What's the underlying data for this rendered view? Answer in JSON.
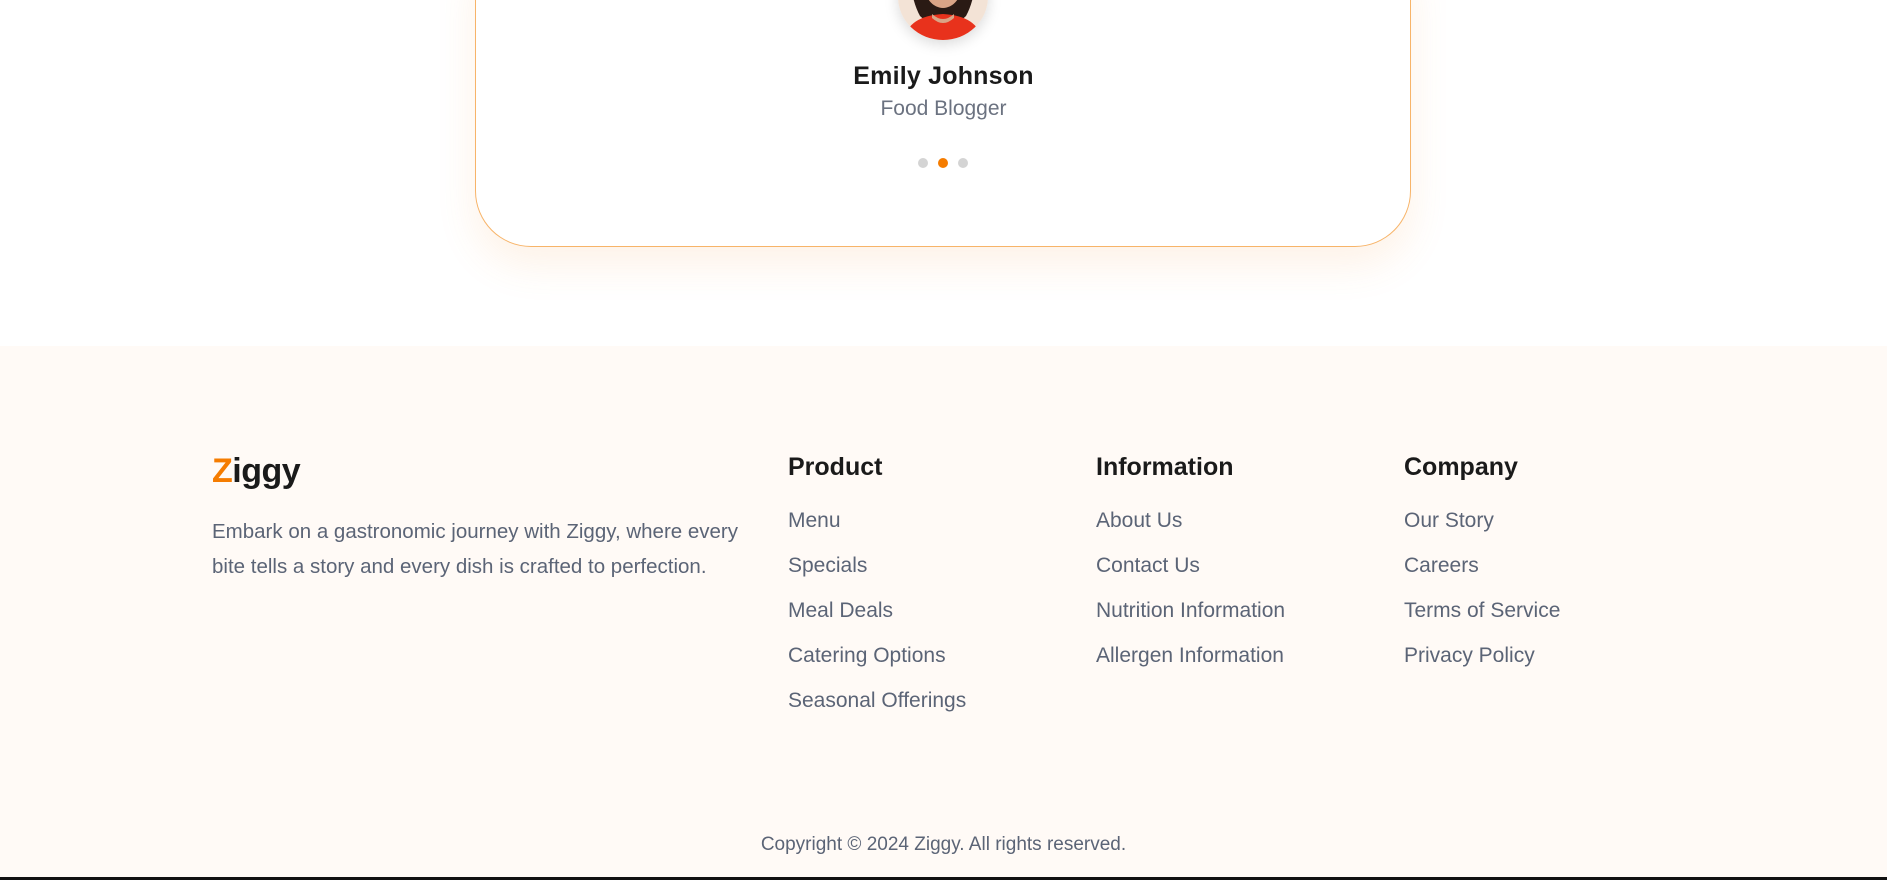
{
  "testimonial": {
    "name": "Emily Johnson",
    "role": "Food Blogger",
    "dots_total": 3,
    "dots_active_index": 1
  },
  "footer": {
    "brand": {
      "first_letter": "Z",
      "rest": "iggy",
      "description": "Embark on a gastronomic journey with Ziggy, where every bite tells a story and every dish is crafted to perfection."
    },
    "columns": {
      "product": {
        "title": "Product",
        "links": [
          "Menu",
          "Specials",
          "Meal Deals",
          "Catering Options",
          "Seasonal Offerings"
        ]
      },
      "information": {
        "title": "Information",
        "links": [
          "About Us",
          "Contact Us",
          "Nutrition Information",
          "Allergen Information"
        ]
      },
      "company": {
        "title": "Company",
        "links": [
          "Our Story",
          "Careers",
          "Terms of Service",
          "Privacy Policy"
        ]
      }
    },
    "copyright": "Copyright © 2024 Ziggy. All rights reserved."
  },
  "colors": {
    "accent": "#f57c00",
    "card_border": "#f7b469",
    "footer_bg": "#fffaf6",
    "heading": "#1a1a1a",
    "body_text": "#5b6476"
  },
  "icons": {
    "avatar": "woman-portrait-avatar"
  }
}
